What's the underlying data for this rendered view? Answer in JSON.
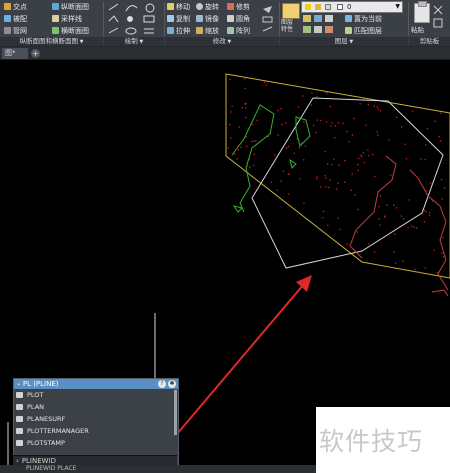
{
  "ribbon": {
    "buttons": [
      {
        "label": "交点",
        "icon": "intersection-icon"
      },
      {
        "label": "被配",
        "icon": "dock-icon"
      },
      {
        "label": "管网",
        "icon": "pipe-network-icon"
      },
      {
        "label": "纵断面图",
        "icon": "profile-icon"
      },
      {
        "label": "采样线",
        "icon": "sample-line-icon"
      },
      {
        "label": "横断面图",
        "icon": "section-view-icon"
      },
      {
        "label": "移动",
        "icon": "move-icon"
      },
      {
        "label": "旋转",
        "icon": "rotate-icon"
      },
      {
        "label": "修剪",
        "icon": "trim-icon"
      },
      {
        "label": "复制",
        "icon": "copy-icon"
      },
      {
        "label": "镜像",
        "icon": "mirror-icon"
      },
      {
        "label": "圆角",
        "icon": "fillet-icon"
      },
      {
        "label": "拉伸",
        "icon": "stretch-icon"
      },
      {
        "label": "缩放",
        "icon": "scale-icon"
      },
      {
        "label": "阵列",
        "icon": "array-icon"
      },
      {
        "label": "置为当前",
        "icon": "set-current-icon"
      },
      {
        "label": "匹配图层",
        "icon": "match-layer-icon"
      }
    ],
    "panels": {
      "profile": "纵断面图和横断面图",
      "draw": "绘制",
      "modify": "修改",
      "layer": "图层",
      "clipboard": "剪贴板"
    },
    "layer_props_label": "图层\n特性",
    "layer_value": "0",
    "paste_label": "粘贴"
  },
  "tabs": {
    "document": "图*",
    "add": "+"
  },
  "command_palette": {
    "title": "PL (PLINE)",
    "items": [
      "PLOT",
      "PLAN",
      "PLANESURF",
      "PLOTTERMANAGER",
      "PLOTSTAMP"
    ],
    "cmdline": "PLINEWID"
  },
  "status": {
    "text": "PLINEWID  PLACE"
  },
  "watermark": "软件技巧",
  "colors": {
    "canvas": "#000000",
    "boundary": "#c7b33a",
    "pline": "#d8d8d8",
    "contour_green": "#2fb52f",
    "contour_red": "#c04040",
    "points": "#d02020",
    "arrow": "#e02828",
    "palette_header": "#5a8fc6"
  }
}
